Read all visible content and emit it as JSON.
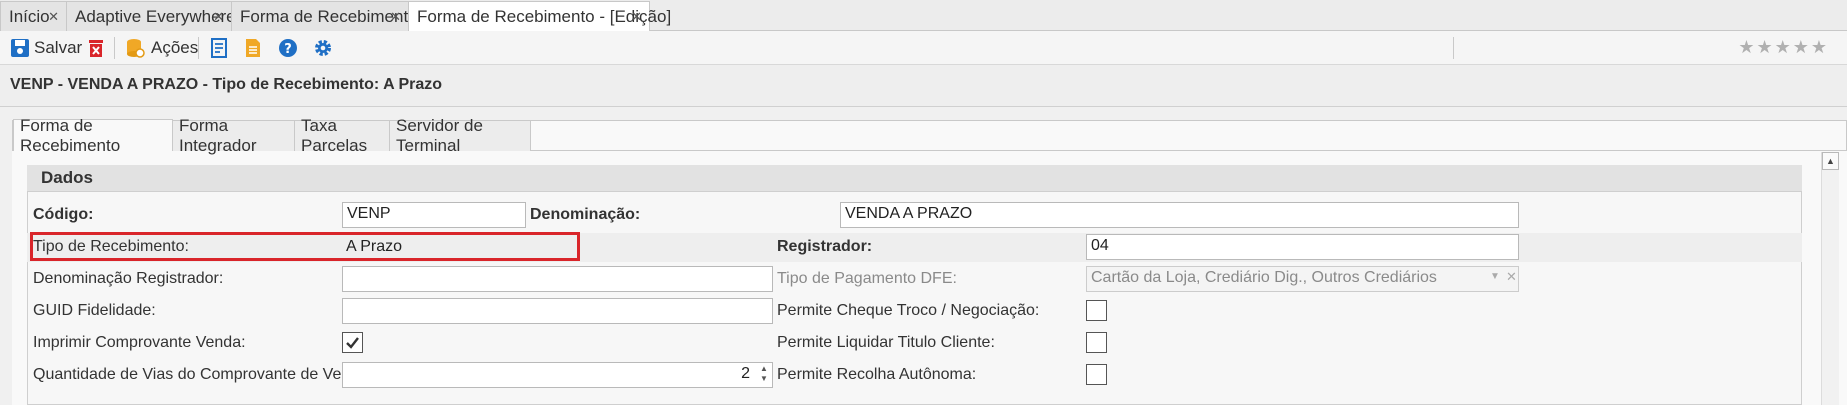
{
  "tabs": [
    {
      "label": "Início"
    },
    {
      "label": "Adaptive Everywhere"
    },
    {
      "label": "Forma de Recebimento"
    },
    {
      "label": "Forma de Recebimento - [Edição]"
    }
  ],
  "toolbar": {
    "save_label": "Salvar",
    "actions_label": "Ações",
    "stars": "★★★★★"
  },
  "header": {
    "title": "VENP - VENDA A PRAZO - Tipo de Recebimento: A Prazo"
  },
  "form_tabs": [
    {
      "label": "Forma de Recebimento"
    },
    {
      "label": "Forma Integrador"
    },
    {
      "label": "Taxa Parcelas"
    },
    {
      "label": "Servidor de Terminal"
    }
  ],
  "section": {
    "title": "Dados"
  },
  "fields": {
    "codigo_label": "Código:",
    "codigo_value": "VENP",
    "denominacao_label": "Denominação:",
    "denominacao_value": "VENDA A PRAZO",
    "tipo_label": "Tipo de Recebimento:",
    "tipo_value": "A Prazo",
    "registrador_label": "Registrador:",
    "registrador_value": "04",
    "den_registrador_label": "Denominação Registrador:",
    "den_registrador_value": "",
    "tipo_pagamento_label": "Tipo de Pagamento DFE:",
    "tipo_pagamento_value": "Cartão da Loja, Crediário Dig., Outros Crediários",
    "guid_label": "GUID Fidelidade:",
    "guid_value": "",
    "permite_cheque_label": "Permite Cheque Troco / Negociação:",
    "permite_cheque_checked": false,
    "imprimir_label": "Imprimir Comprovante Venda:",
    "imprimir_checked": true,
    "permite_liquidar_label": "Permite Liquidar Titulo Cliente:",
    "permite_liquidar_checked": false,
    "quantidade_label": "Quantidade de Vias do Comprovante de Venda:",
    "quantidade_value": "2",
    "permite_recolha_label": "Permite Recolha Autônoma:",
    "permite_recolha_checked": false
  },
  "colors": {
    "highlight": "#d9252a",
    "accent_blue": "#1f6fc5"
  }
}
